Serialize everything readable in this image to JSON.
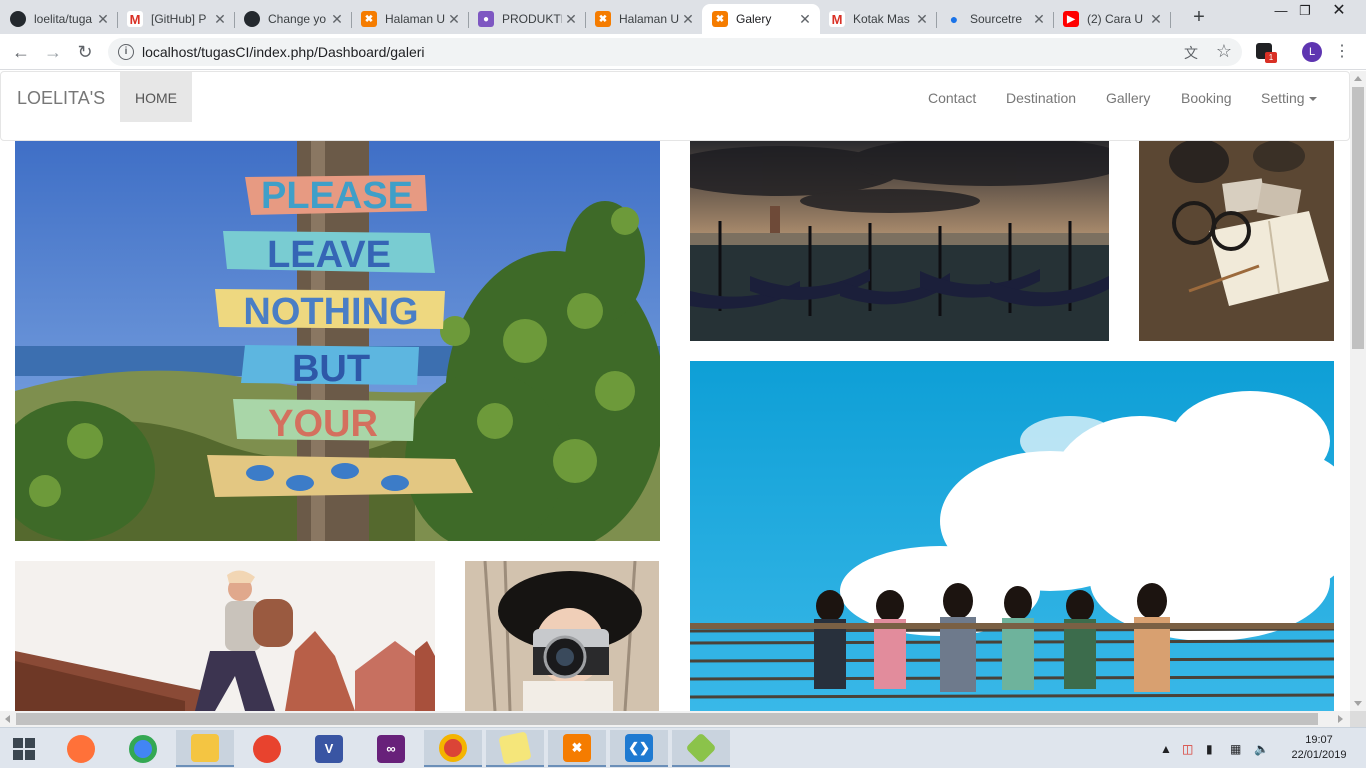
{
  "browser": {
    "tabs": [
      {
        "title": "loelita/tuga",
        "icon": "github-icon",
        "active": false
      },
      {
        "title": "[GitHub] P",
        "icon": "gmail-icon",
        "active": false
      },
      {
        "title": "Change yo",
        "icon": "github-icon",
        "active": false
      },
      {
        "title": "Halaman U",
        "icon": "xampp-icon",
        "active": false
      },
      {
        "title": "PRODUKTI",
        "icon": "classroom-icon",
        "active": false
      },
      {
        "title": "Halaman U",
        "icon": "xampp-icon",
        "active": false
      },
      {
        "title": "Galery",
        "icon": "xampp-icon",
        "active": true
      },
      {
        "title": "Kotak Mas",
        "icon": "gmail-icon",
        "active": false
      },
      {
        "title": "Sourcetre",
        "icon": "maps-pin-icon",
        "active": false
      },
      {
        "title": "(2) Cara U",
        "icon": "youtube-icon",
        "active": false
      }
    ],
    "url": "localhost/tugasCI/index.php/Dashboard/galeri",
    "profile_initial": "L",
    "extension_badge": "1"
  },
  "site": {
    "brand": "LOELITA'S",
    "home": "HOME",
    "nav": {
      "contact": "Contact",
      "destination": "Destination",
      "gallery": "Gallery",
      "booking": "Booking",
      "setting": "Setting"
    }
  },
  "gallery": {
    "sign_words": [
      "PLEASE",
      "LEAVE",
      "NOTHING",
      "BUT",
      "YOUR"
    ],
    "photos": [
      {
        "subject": "wooden signpost on beach"
      },
      {
        "subject": "gondolas in Venice at dusk"
      },
      {
        "subject": "glasses and notebook on desk"
      },
      {
        "subject": "group of girls under blue sky"
      },
      {
        "subject": "hiker climbing ancient ruins"
      },
      {
        "subject": "woman with camera and black hat"
      }
    ]
  },
  "taskbar": {
    "time": "19:07",
    "date": "22/01/2019"
  }
}
